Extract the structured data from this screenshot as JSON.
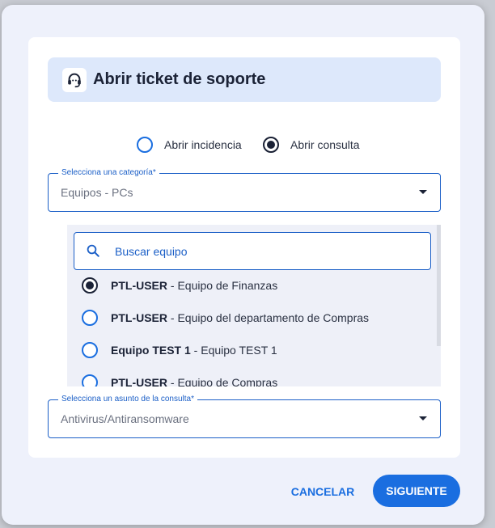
{
  "modal": {
    "title": "Abrir ticket de soporte",
    "icon": "headset-icon",
    "accent_color": "#1a6ee0"
  },
  "ticket_type": {
    "options": [
      {
        "label": "Abrir incidencia",
        "selected": false
      },
      {
        "label": "Abrir consulta",
        "selected": true
      }
    ]
  },
  "category_select": {
    "label": "Selecciona una categoría*",
    "value": "Equipos - PCs"
  },
  "equipment_list": {
    "search_placeholder": "Buscar equipo",
    "items": [
      {
        "name": "PTL-USER",
        "separator": " - ",
        "description": "Equipo de Finanzas",
        "selected": true
      },
      {
        "name": "PTL-USER",
        "separator": " - ",
        "description": "Equipo del departamento de Compras",
        "selected": false
      },
      {
        "name": "Equipo TEST 1",
        "separator": " - ",
        "description": "Equipo TEST 1",
        "selected": false
      },
      {
        "name": "PTL-USER",
        "separator": " - ",
        "description": "Equipo de Compras",
        "selected": false
      }
    ]
  },
  "subject_select": {
    "label": "Selecciona un asunto de la consulta*",
    "value": "Antivirus/Antiransomware"
  },
  "footer": {
    "cancel_label": "CANCELAR",
    "next_label": "SIGUIENTE"
  }
}
